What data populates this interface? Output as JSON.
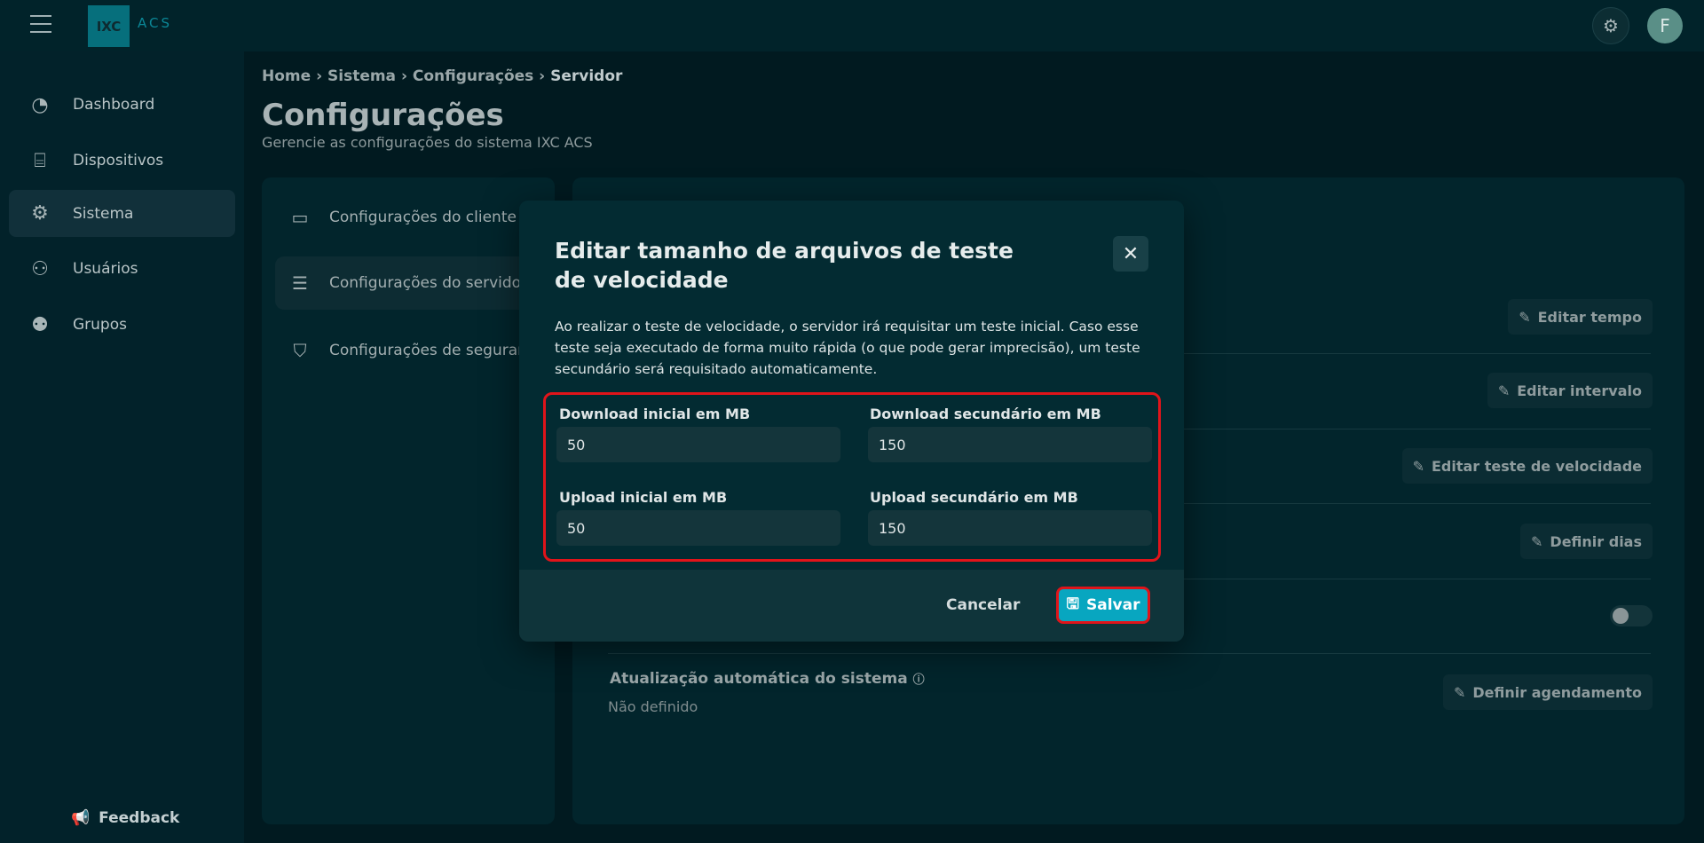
{
  "header": {
    "logo_text": "IXC",
    "logo_suffix": "ACS",
    "avatar_initial": "F"
  },
  "sidebar": {
    "items": [
      {
        "label": "Dashboard",
        "icon": "pie-chart-icon"
      },
      {
        "label": "Dispositivos",
        "icon": "router-icon"
      },
      {
        "label": "Sistema",
        "icon": "gear-icon",
        "active": true
      },
      {
        "label": "Usuários",
        "icon": "users-icon"
      },
      {
        "label": "Grupos",
        "icon": "groups-icon"
      }
    ],
    "feedback": "Feedback"
  },
  "breadcrumb": [
    "Home",
    "Sistema",
    "Configurações",
    "Servidor"
  ],
  "page": {
    "title": "Configurações",
    "subtitle": "Gerencie as configurações do sistema IXC ACS"
  },
  "settings_nav": [
    {
      "label": "Configurações do cliente"
    },
    {
      "label": "Configurações do servidor",
      "active": true
    },
    {
      "label": "Configurações de segurança"
    }
  ],
  "settings_rows": {
    "buttons": [
      "Editar tempo",
      "Editar intervalo",
      "Editar teste de velocidade",
      "Definir dias",
      "Definir agendamento"
    ],
    "auto_update_label": "Atualização automática do sistema",
    "auto_update_value": "Não definido",
    "toggle_on": false
  },
  "modal": {
    "title": "Editar tamanho de arquivos de teste de velocidade",
    "description": "Ao realizar o teste de velocidade, o servidor irá requisitar um teste inicial. Caso esse teste seja executado de forma muito rápida (o que pode gerar imprecisão), um teste secundário será requisitado automaticamente.",
    "fields": [
      {
        "label": "Download inicial em MB",
        "value": "50"
      },
      {
        "label": "Download secundário em MB",
        "value": "150"
      },
      {
        "label": "Upload inicial em MB",
        "value": "50"
      },
      {
        "label": "Upload secundário em MB",
        "value": "150"
      }
    ],
    "cancel": "Cancelar",
    "save": "Salvar"
  },
  "colors": {
    "accent": "#08a6c0",
    "highlight": "#e0141a"
  }
}
